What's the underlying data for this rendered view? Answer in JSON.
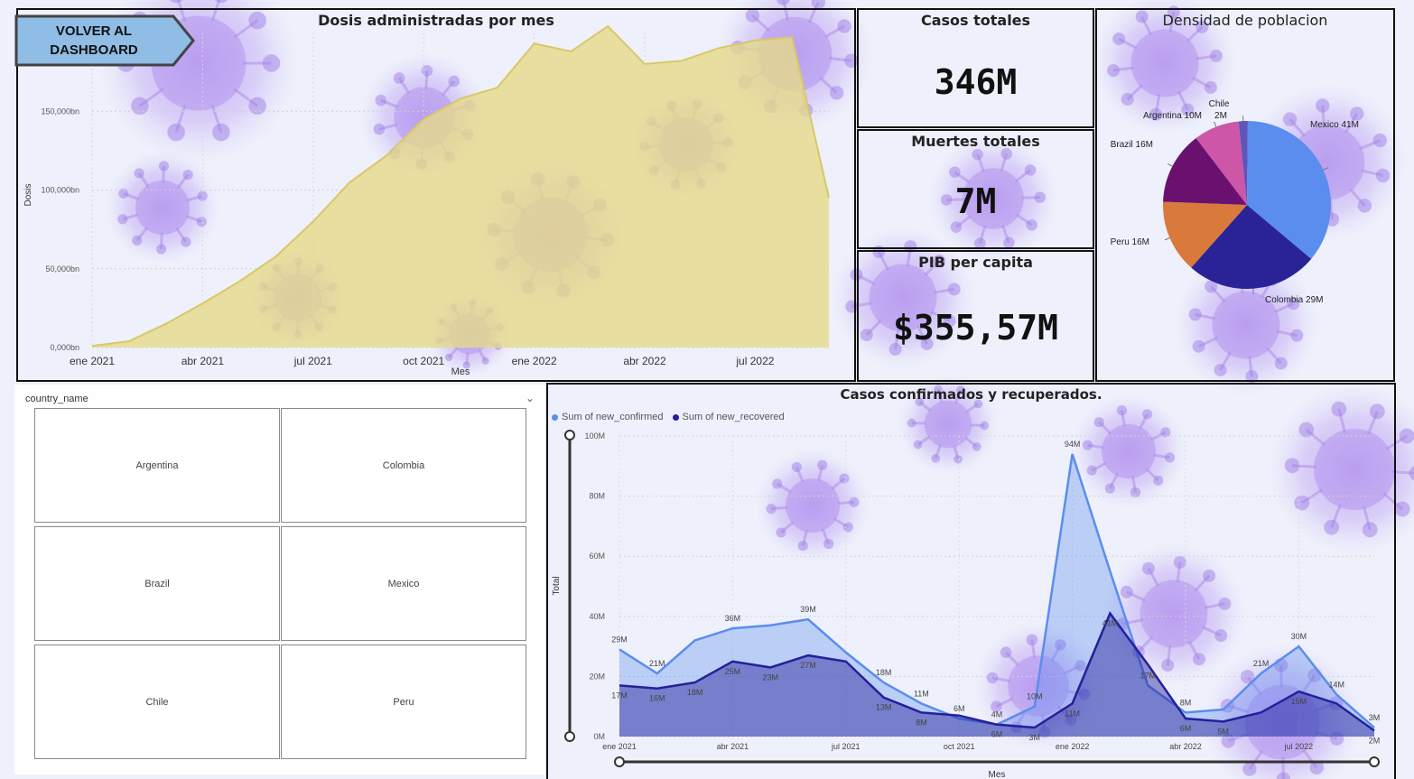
{
  "back_button": {
    "label_line1": "VOLVER AL",
    "label_line2": "DASHBOARD"
  },
  "dosis_chart": {
    "title": "Dosis administradas por mes",
    "xlabel": "Mes",
    "ylabel": "Dosis"
  },
  "kpis": {
    "casos": {
      "title": "Casos totales",
      "value": "346M"
    },
    "muertes": {
      "title": "Muertes totales",
      "value": "7M"
    },
    "pib": {
      "title": "PIB per capita",
      "value": "$355,57M"
    }
  },
  "densidad_chart": {
    "title": "Densidad de poblacion"
  },
  "slicer": {
    "header": "country_name",
    "options": [
      "Argentina",
      "Colombia",
      "Brazil",
      "Mexico",
      "Chile",
      "Peru"
    ]
  },
  "casos_chart": {
    "title": "Casos confirmados y recuperados.",
    "xlabel": "Mes",
    "ylabel": "Total",
    "legend": [
      "Sum of new_confirmed",
      "Sum of new_recovered"
    ]
  },
  "colors": {
    "confirmed": "#5b8def",
    "recovered": "#23209a",
    "dosis_fill": "#e6d98a",
    "pie_mexico": "#5b8def",
    "pie_colombia": "#2a2397",
    "pie_peru": "#d9793c",
    "pie_brazil": "#6a1170",
    "pie_argentina": "#cd56a8",
    "pie_chile": "#5f55b8"
  },
  "chart_data": [
    {
      "type": "area",
      "title": "Dosis administradas por mes",
      "xlabel": "Mes",
      "ylabel": "Dosis",
      "x": [
        "ene 2021",
        "feb 2021",
        "mar 2021",
        "abr 2021",
        "may 2021",
        "jun 2021",
        "jul 2021",
        "ago 2021",
        "sep 2021",
        "oct 2021",
        "nov 2021",
        "dic 2021",
        "ene 2022",
        "feb 2022",
        "mar 2022",
        "abr 2022",
        "may 2022",
        "jun 2022",
        "jul 2022",
        "ago 2022",
        "sep 2022"
      ],
      "values": [
        1,
        4,
        15,
        28,
        42,
        58,
        80,
        105,
        122,
        145,
        158,
        165,
        193,
        188,
        204,
        180,
        182,
        190,
        195,
        197,
        95
      ],
      "ylim": [
        0,
        200
      ],
      "y_ticks": [
        "0,000bn",
        "50,000bn",
        "100,000bn",
        "150,000bn"
      ],
      "y_tick_values": [
        0,
        50,
        100,
        150
      ],
      "x_ticks": [
        "ene 2021",
        "abr 2021",
        "jul 2021",
        "oct 2021",
        "ene 2022",
        "abr 2022",
        "jul 2022"
      ]
    },
    {
      "type": "pie",
      "title": "Densidad de poblacion",
      "labels": [
        "Mexico",
        "Colombia",
        "Peru",
        "Brazil",
        "Argentina",
        "Chile"
      ],
      "values": [
        41,
        29,
        16,
        16,
        10,
        2
      ],
      "data_labels": [
        "Mexico 41M",
        "Colombia 29M",
        "Peru 16M",
        "Brazil 16M",
        "Argentina 10M",
        "2M"
      ],
      "extra_label": "Chile"
    },
    {
      "type": "area",
      "title": "Casos confirmados y recuperados.",
      "xlabel": "Mes",
      "ylabel": "Total",
      "x": [
        "ene 2021",
        "feb 2021",
        "mar 2021",
        "abr 2021",
        "may 2021",
        "jun 2021",
        "jul 2021",
        "ago 2021",
        "sep 2021",
        "oct 2021",
        "nov 2021",
        "dic 2021",
        "ene 2022",
        "feb 2022",
        "mar 2022",
        "abr 2022",
        "may 2022",
        "jun 2022",
        "jul 2022",
        "ago 2022",
        "sep 2022"
      ],
      "ylim": [
        0,
        100
      ],
      "y_ticks": [
        "0M",
        "20M",
        "40M",
        "60M",
        "80M",
        "100M"
      ],
      "y_tick_values": [
        0,
        20,
        40,
        60,
        80,
        100
      ],
      "x_ticks": [
        "ene 2021",
        "abr 2021",
        "jul 2021",
        "oct 2021",
        "ene 2022",
        "abr 2022",
        "jul 2022"
      ],
      "series": [
        {
          "name": "Sum of new_confirmed",
          "values": [
            29,
            21,
            32,
            36,
            37,
            39,
            28,
            18,
            11,
            6,
            4,
            10,
            94,
            55,
            17,
            8,
            9,
            21,
            30,
            14,
            3
          ],
          "labels": [
            "29M",
            "21M",
            "",
            "36M",
            "",
            "39M",
            "",
            "18M",
            "11M",
            "6M",
            "4M",
            "10M",
            "94M",
            "",
            "17M",
            "8M",
            "",
            "21M",
            "30M",
            "14M",
            "3M"
          ]
        },
        {
          "name": "Sum of new_recovered",
          "values": [
            17,
            16,
            18,
            25,
            23,
            27,
            25,
            13,
            8,
            7,
            4,
            3,
            11,
            41,
            24,
            6,
            5,
            8,
            15,
            11,
            2
          ],
          "labels": [
            "17M",
            "16M",
            "18M",
            "25M",
            "23M",
            "27M",
            "",
            "13M",
            "8M",
            "",
            "6M",
            "3M",
            "11M",
            "41M",
            "",
            "6M",
            "5M",
            "",
            "15M",
            "",
            "2M"
          ]
        }
      ]
    }
  ]
}
